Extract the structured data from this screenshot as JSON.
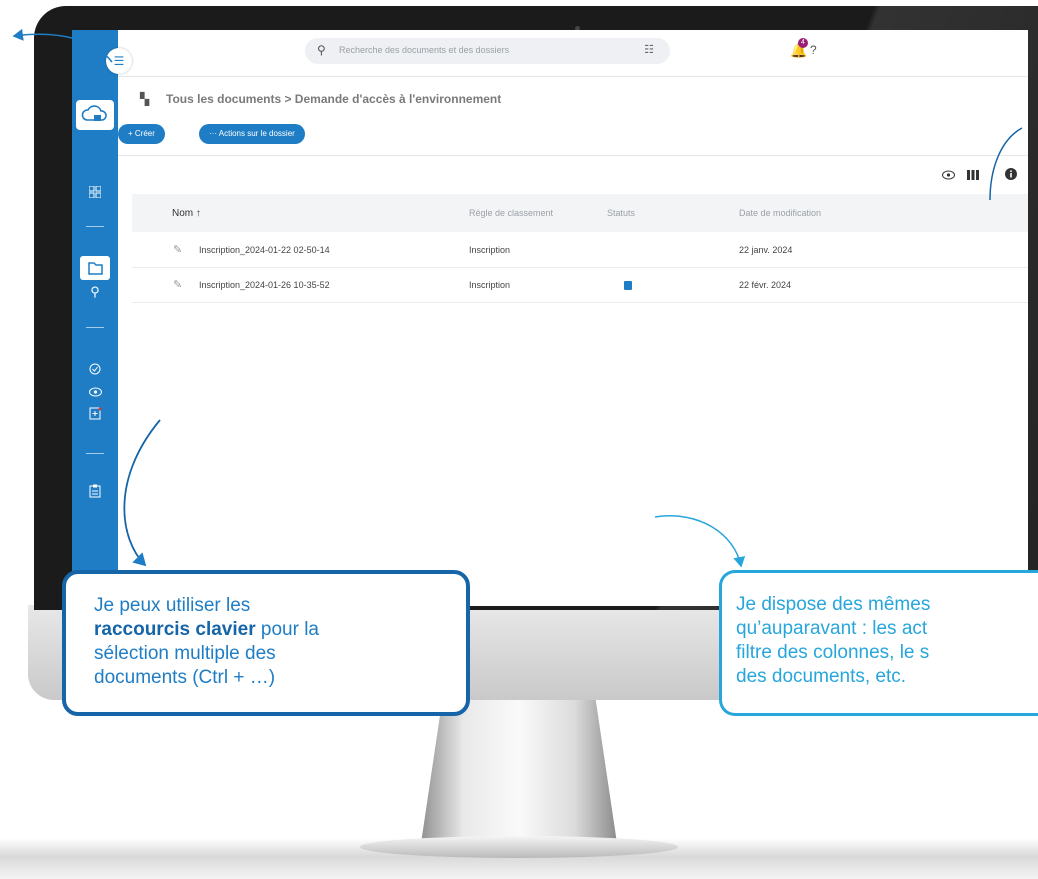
{
  "app": {
    "search_placeholder": "Recherche des documents et des dossiers",
    "notification_count": "4"
  },
  "breadcrumb": {
    "text": "Tous les documents > Demande d'accès à l'environnement"
  },
  "actions": {
    "create_label": "+ Créer",
    "folder_actions_label": "··· Actions sur le dossier"
  },
  "table": {
    "headers": {
      "name": "Nom  ↑",
      "rule": "Règle de classement",
      "status": "Statuts",
      "modified": "Date de modification"
    },
    "rows": [
      {
        "name": "Inscription_2024-01-22 02-50-14",
        "rule": "Inscription",
        "status": "",
        "date": "22 janv. 2024"
      },
      {
        "name": "Inscription_2024-01-26 10-35-52",
        "rule": "Inscription",
        "status": "document",
        "date": "22 févr. 2024"
      }
    ]
  },
  "callouts": {
    "left": {
      "line1": "Je peux utiliser les",
      "bold": "raccourcis clavier",
      "line2_rest": " pour la",
      "line3": "sélection multiple des",
      "line4": "documents (Ctrl + …)"
    },
    "right": {
      "line1": "Je dispose des mêmes",
      "line2": "qu’auparavant : les act",
      "line3": "filtre des colonnes, le s",
      "line4": "des documents, etc."
    }
  },
  "colors": {
    "brand_blue": "#1f7dc5",
    "callout_dark": "#1565a8",
    "callout_light": "#27a6db",
    "badge": "#9b1f74"
  },
  "icons": {
    "sidebar": [
      "cloud-icon",
      "dashboard-icon",
      "folder-icon",
      "search-icon",
      "check-circle-icon",
      "eye-icon",
      "add-document-icon",
      "clipboard-icon"
    ],
    "toolbar": [
      "eye-icon",
      "columns-icon",
      "info-icon"
    ]
  }
}
